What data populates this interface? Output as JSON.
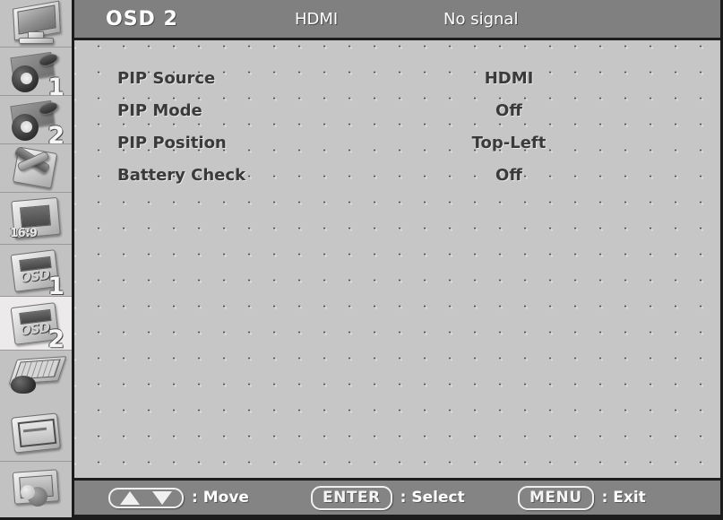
{
  "header": {
    "title": "OSD 2",
    "source": "HDMI",
    "status": "No signal"
  },
  "menu": {
    "rows": [
      {
        "label": "PIP Source",
        "value": "HDMI"
      },
      {
        "label": "PIP Mode",
        "value": "Off"
      },
      {
        "label": "PIP Position",
        "value": "Top-Left"
      },
      {
        "label": "Battery Check",
        "value": "Off"
      }
    ]
  },
  "sidebar": {
    "items": [
      {
        "name": "display",
        "icon": "monitor-icon",
        "badge": "",
        "selected": false
      },
      {
        "name": "camera-1",
        "icon": "camera-film-icon",
        "badge": "1",
        "selected": false
      },
      {
        "name": "camera-2",
        "icon": "camera-film-icon",
        "badge": "2",
        "selected": false
      },
      {
        "name": "tools",
        "icon": "tools-icon",
        "badge": "",
        "selected": false
      },
      {
        "name": "aspect",
        "icon": "aspect-ratio-icon",
        "badge": "16:9",
        "selected": false
      },
      {
        "name": "osd-1",
        "icon": "osd-icon",
        "badge": "1",
        "selected": false
      },
      {
        "name": "osd-2",
        "icon": "osd-icon",
        "badge": "2",
        "selected": true
      },
      {
        "name": "input",
        "icon": "keyboard-icon",
        "badge": "",
        "selected": false
      },
      {
        "name": "panel",
        "icon": "panel-icon",
        "badge": "",
        "selected": false
      },
      {
        "name": "info",
        "icon": "info-monitor-icon",
        "badge": "",
        "selected": false
      }
    ],
    "aspect_label": "16:9",
    "osd_word": "OSD"
  },
  "footer": {
    "hints": [
      {
        "key": "arrows",
        "label": ": Move"
      },
      {
        "key": "ENTER",
        "label": ": Select"
      },
      {
        "key": "MENU",
        "label": ": Exit"
      }
    ],
    "enter_key": "ENTER",
    "menu_key": "MENU"
  },
  "colors": {
    "panel_bg": "#c6c6c6",
    "title_bar": "#808080",
    "footer_bar": "#848484",
    "selected_item": "#eceaea",
    "text_dark": "#3a3a3a",
    "text_light": "#ffffff"
  }
}
